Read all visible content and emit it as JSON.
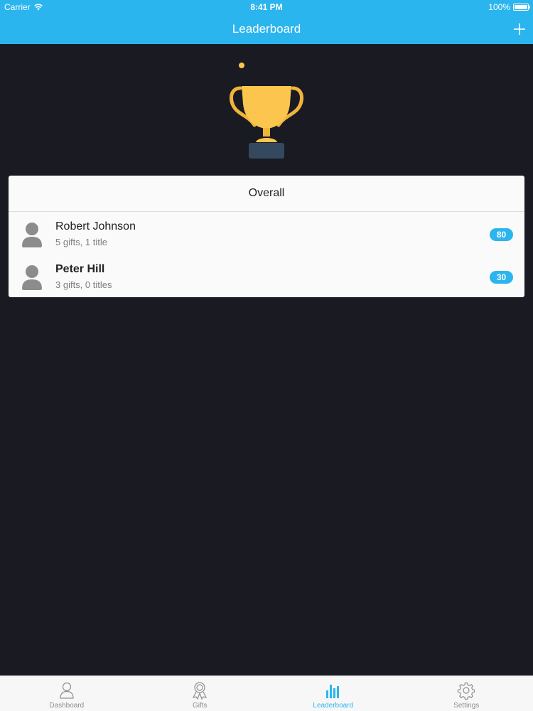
{
  "status_bar": {
    "carrier": "Carrier",
    "time": "8:41 PM",
    "battery": "100%"
  },
  "nav": {
    "title": "Leaderboard",
    "add_icon": "plus-icon"
  },
  "hero": {
    "icon": "trophy-icon",
    "colors": {
      "gold": "#fbc54e",
      "base": "#34495e"
    }
  },
  "leaderboard": {
    "header": "Overall",
    "entries": [
      {
        "name": "Robert Johnson",
        "subtitle": "5 gifts, 1 title",
        "score": "80"
      },
      {
        "name": "Peter Hill",
        "subtitle": "3 gifts, 0 titles",
        "score": "30"
      }
    ]
  },
  "tabs": [
    {
      "label": "Dashboard",
      "icon": "person-icon",
      "active": false
    },
    {
      "label": "Gifts",
      "icon": "ribbon-award-icon",
      "active": false
    },
    {
      "label": "Leaderboard",
      "icon": "bar-chart-icon",
      "active": true
    },
    {
      "label": "Settings",
      "icon": "gear-icon",
      "active": false
    }
  ],
  "colors": {
    "accent": "#2bb5ee",
    "background": "#191a22",
    "inactive_tab": "#8e8e93"
  }
}
